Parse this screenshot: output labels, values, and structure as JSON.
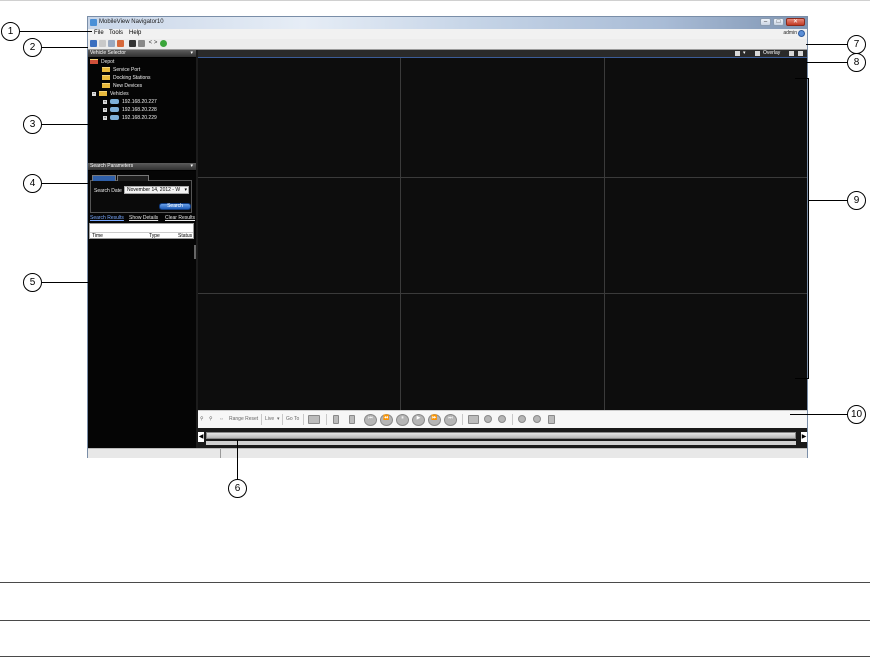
{
  "window": {
    "title": "MobileView Navigator10",
    "minimize": "–",
    "maximize": "□",
    "close": "✕"
  },
  "menu": {
    "file": "File",
    "tools": "Tools",
    "help": "Help"
  },
  "user": {
    "name": "admin"
  },
  "toolbar": {
    "icons": [
      "save-icon",
      "list-icon",
      "print-icon",
      "edit-icon",
      "clip-icon",
      "settings-icon",
      "link-icon",
      "connect-icon"
    ],
    "link_label": "< >"
  },
  "vehicle_selector": {
    "header": "Vehicle Selector",
    "tree": {
      "root": "Depot",
      "service_port": "Service Port",
      "docking_stations": "Docking Stations",
      "new_devices": "New Devices",
      "vehicles": "Vehicles",
      "ips": [
        "192.168.20.227",
        "192.168.20.228",
        "192.168.20.229"
      ]
    }
  },
  "search_parameters": {
    "header": "Search Parameters",
    "search_date_label": "Search Date",
    "search_date_value": "November 14, 2012 - W",
    "search_button": "Search"
  },
  "results": {
    "search_results_link": "Search Results",
    "show_details_link": "Show Details",
    "clear_results_link": "Clear Results",
    "columns": [
      "Time",
      "Type",
      "Status"
    ]
  },
  "video": {
    "overlay_label": "Overlay",
    "grid": {
      "rows": 3,
      "cols": 3
    }
  },
  "playback": {
    "range_reset": "Range Reset",
    "live": "Live",
    "go_to": "Go To"
  },
  "callouts": [
    "1",
    "2",
    "3",
    "4",
    "5",
    "6",
    "7",
    "8",
    "9",
    "10"
  ]
}
